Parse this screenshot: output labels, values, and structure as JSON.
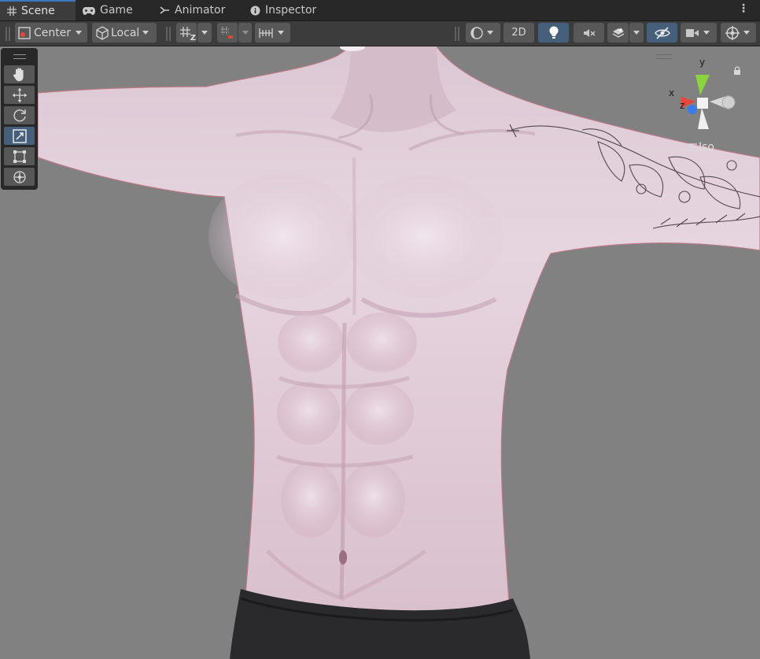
{
  "tabs": [
    {
      "label": "Scene",
      "icon": "grid-icon",
      "active": true
    },
    {
      "label": "Game",
      "icon": "gamepad-icon",
      "active": false
    },
    {
      "label": "Animator",
      "icon": "animator-icon",
      "active": false
    },
    {
      "label": "Inspector",
      "icon": "info-icon",
      "active": false
    }
  ],
  "toolbar": {
    "pivot_label": "Center",
    "space_label": "Local",
    "mode_2d_label": "2D",
    "grid_snap_label": "Z"
  },
  "tools": [
    {
      "name": "hand-tool",
      "icon": "hand-icon",
      "active": false
    },
    {
      "name": "move-tool",
      "icon": "move-icon",
      "active": false
    },
    {
      "name": "rotate-tool",
      "icon": "rotate-icon",
      "active": false
    },
    {
      "name": "scale-tool",
      "icon": "scale-icon",
      "active": true
    },
    {
      "name": "rect-tool",
      "icon": "rect-icon",
      "active": false
    },
    {
      "name": "transform-tool",
      "icon": "transform-icon",
      "active": false
    }
  ],
  "gizmo": {
    "x_label": "x",
    "y_label": "y",
    "z_label": "z",
    "projection_label": "Iso",
    "colors": {
      "x": "#e8453c",
      "y": "#8bd43f",
      "z": "#3c7bea"
    }
  },
  "colors": {
    "tab_bar": "#282828",
    "toolbar": "#3c3c3c",
    "button": "#585858",
    "button_active": "#46607c",
    "viewport_bg": "#818181",
    "skin": "#e6d2dc",
    "shorts": "#2a2a2c"
  }
}
